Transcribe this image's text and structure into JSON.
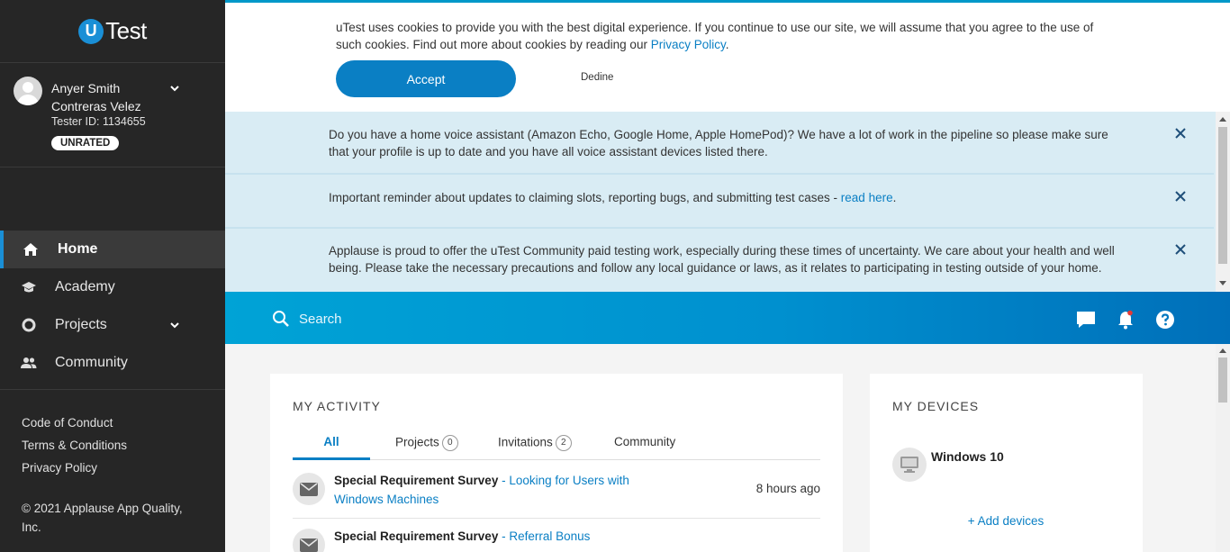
{
  "brand": {
    "logo_letter": "U",
    "logo_text": "Test"
  },
  "profile": {
    "first_name": "Anyer Smith",
    "last_name": "Contreras Velez",
    "tester_id": "Tester ID: 1134655",
    "rating": "UNRATED"
  },
  "nav": [
    {
      "label": "Home",
      "icon": "home-icon"
    },
    {
      "label": "Academy",
      "icon": "graduation-cap-icon"
    },
    {
      "label": "Projects",
      "icon": "circle-icon"
    },
    {
      "label": "Community",
      "icon": "people-icon"
    }
  ],
  "footer_links": [
    "Code of Conduct",
    "Terms & Conditions",
    "Privacy Policy"
  ],
  "copyright": "© 2021 Applause App Quality, Inc.",
  "cookie": {
    "text": "uTest uses cookies to provide you with the best digital experience. If you continue to use our site, we will assume that you agree to the use of such cookies. Find out more about cookies by reading our ",
    "link": "Privacy Policy",
    "end": ".",
    "accept": "Accept",
    "decline": "Dedine"
  },
  "notices": [
    {
      "text": "Do you have a home voice assistant (Amazon Echo, Google Home, Apple HomePod)? We have a lot of work in the pipeline so please make sure that your profile is up to date and you have all voice assistant devices listed there."
    },
    {
      "text": "Important reminder about updates to claiming slots, reporting bugs, and submitting test cases - ",
      "link": "read here",
      "end": "."
    },
    {
      "text": "Applause is proud to offer the uTest Community paid testing work, especially during these times of uncertainty. We care about your health and well being. Please take the necessary precautions and follow any local guidance or laws, as it relates to participating in testing outside of your home."
    }
  ],
  "search": {
    "placeholder": "Search"
  },
  "activity": {
    "title": "MY ACTIVITY",
    "tabs": [
      {
        "label": "All"
      },
      {
        "label": "Projects",
        "count": "0"
      },
      {
        "label": "Invitations",
        "count": "2"
      },
      {
        "label": "Community"
      }
    ],
    "items": [
      {
        "title": "Special Requirement Survey",
        "sep": " - ",
        "link": "Looking for Users with Windows Machines",
        "time": "8 hours ago"
      },
      {
        "title": "Special Requirement Survey",
        "sep": " - ",
        "link": "Referral Bonus"
      }
    ]
  },
  "devices": {
    "title": "MY DEVICES",
    "items": [
      {
        "name": "Windows 10"
      }
    ],
    "add": "+ Add devices"
  },
  "colors": {
    "accent": "#0a7fc4",
    "sidebar": "#262626",
    "notice_bg": "#d9ecf4",
    "notification_dot": "#e53935"
  }
}
